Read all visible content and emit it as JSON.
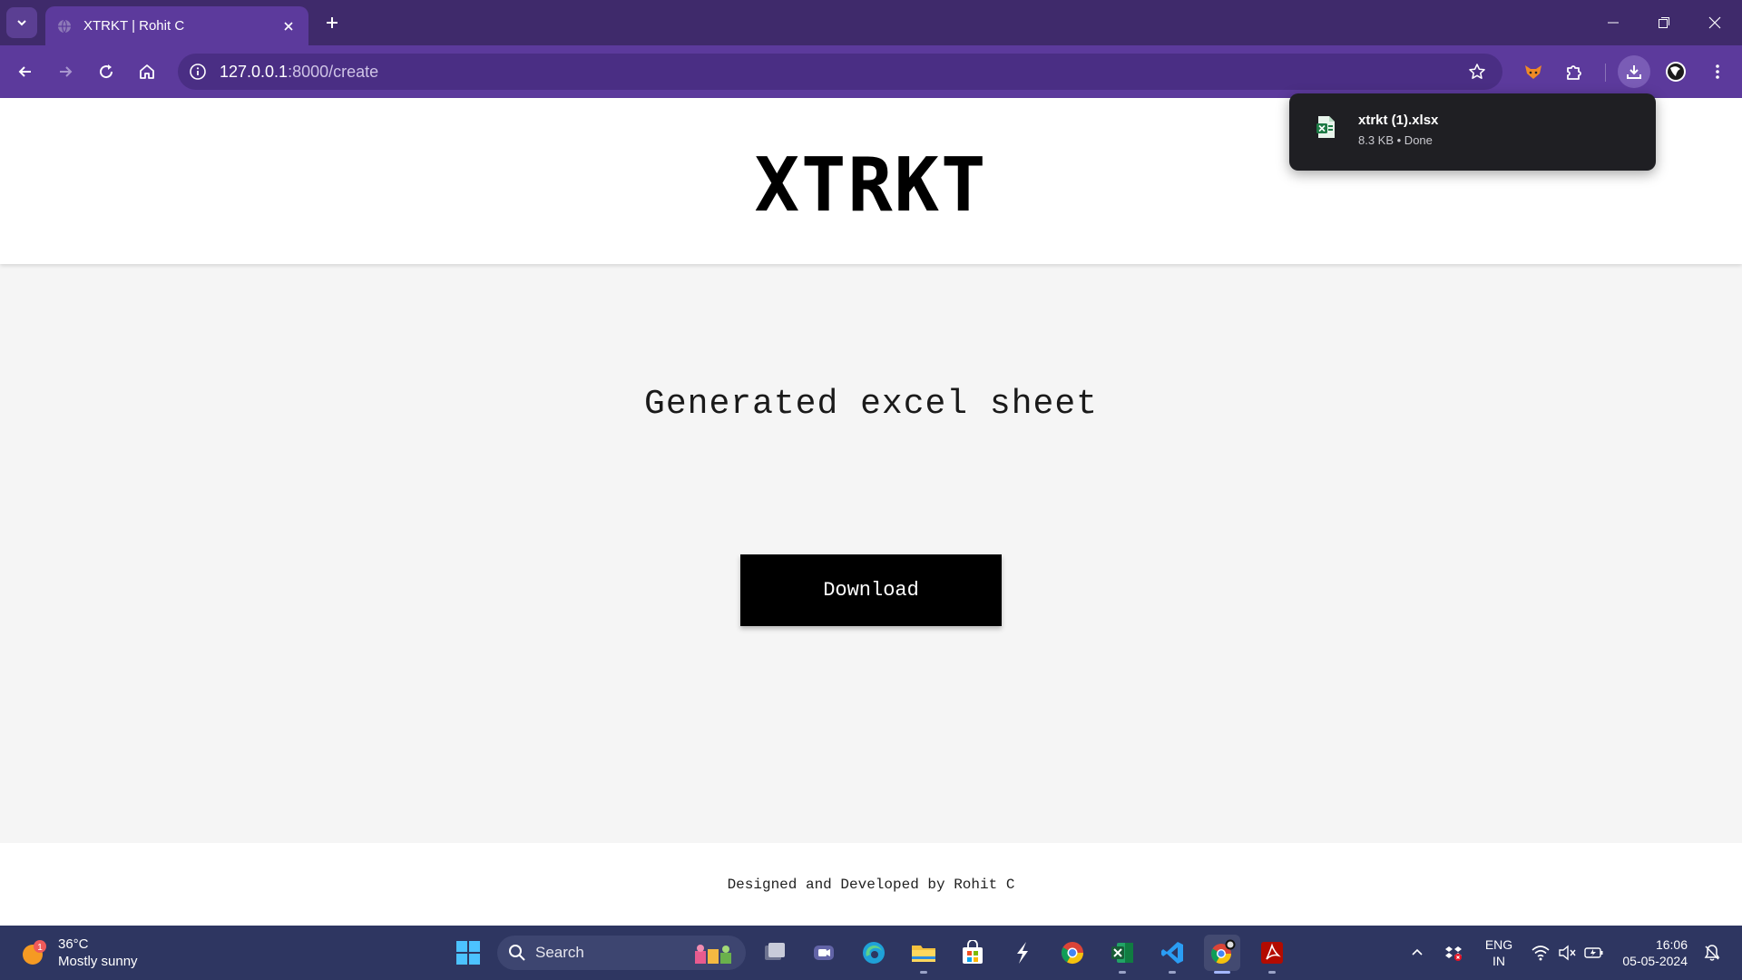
{
  "browser": {
    "tab_title": "XTRKT | Rohit C",
    "url_host": "127.0.0.1",
    "url_path": ":8000/create",
    "accent_color": "#5c3a9c"
  },
  "download_bubble": {
    "file_name": "xtrkt (1).xlsx",
    "file_meta": "8.3 KB • Done",
    "file_icon": "excel-file-icon"
  },
  "page": {
    "logo": "XTRKT",
    "heading": "Generated excel sheet",
    "download_label": "Download",
    "footer": "Designed and Developed by Rohit C"
  },
  "taskbar": {
    "weather_badge": "1",
    "weather_temp": "36°C",
    "weather_condition": "Mostly sunny",
    "search_label": "Search",
    "lang_line1": "ENG",
    "lang_line2": "IN",
    "time": "16:06",
    "date": "05-05-2024",
    "apps": [
      "file-explorer-icon",
      "meet-icon",
      "edge-icon",
      "folder-icon",
      "store-icon",
      "slash-app-icon",
      "chrome-icon",
      "excel-icon",
      "vscode-icon",
      "chrome-profile-icon",
      "acrobat-icon"
    ]
  }
}
